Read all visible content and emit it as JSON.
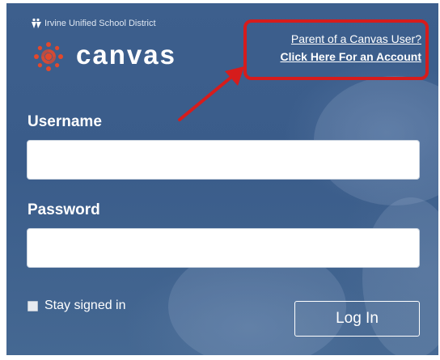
{
  "district": {
    "name": "Irvine Unified School District",
    "logo_icon": "district-figure-icon"
  },
  "brand": {
    "logo_icon": "canvas-logo-icon",
    "name": "canvas",
    "accent_color": "#e3482b"
  },
  "parent_link": {
    "line1": "Parent of a Canvas User?",
    "line2": "Click Here For an Account",
    "highlight_color": "#d61c1c"
  },
  "annotation": {
    "arrow_icon": "red-arrow-icon"
  },
  "form": {
    "username_label": "Username",
    "username_value": "",
    "password_label": "Password",
    "password_value": "",
    "stay_signed_in_label": "Stay signed in",
    "stay_signed_in_checked": false,
    "login_button": "Log In"
  },
  "colors": {
    "background": "#3d5f8d",
    "text": "#ffffff"
  }
}
